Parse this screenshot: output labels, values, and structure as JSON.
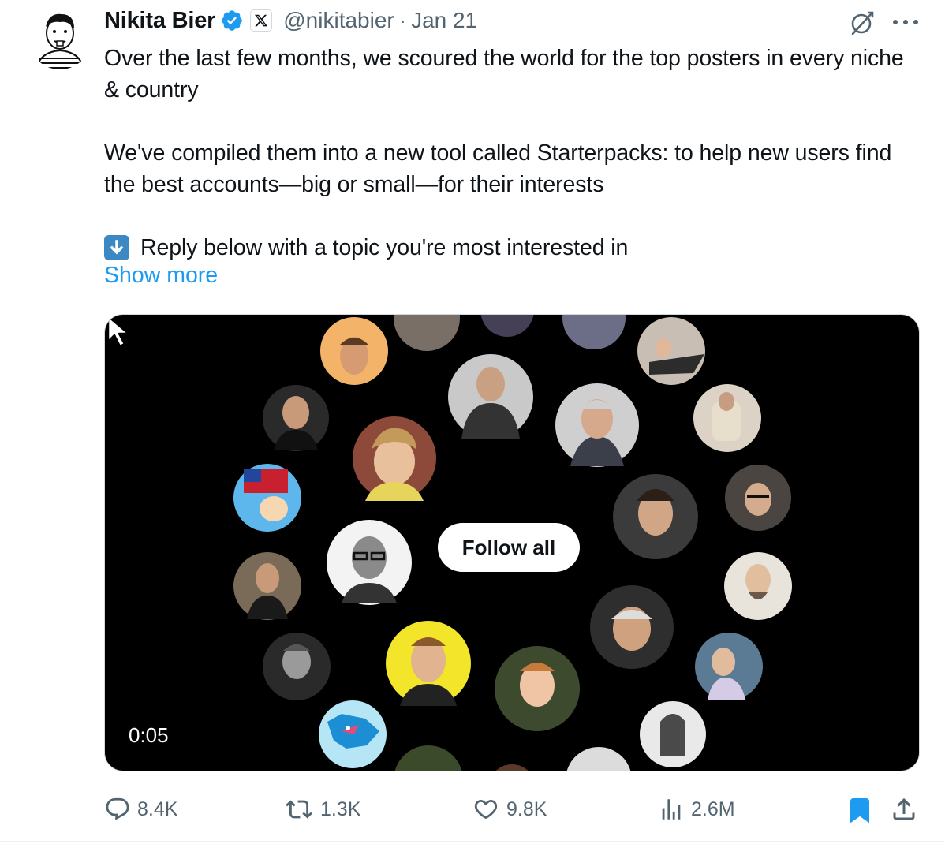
{
  "author": {
    "name": "Nikita Bier",
    "handle": "@nikitabier",
    "separator": "·",
    "date": "Jan 21"
  },
  "tweet": {
    "paragraph1": "Over the last few months, we scoured the world for the top posters in every niche & country",
    "paragraph2": "We've compiled them into a new tool called Starterpacks: to help new users find the best accounts—big or small—for their interests",
    "paragraph3": "Reply below with a topic you're most interested in",
    "show_more": "Show more"
  },
  "media": {
    "follow_button": "Follow all",
    "timestamp": "0:05"
  },
  "stats": {
    "replies": "8.4K",
    "reposts": "1.3K",
    "likes": "9.8K",
    "views": "2.6M"
  },
  "icons": {
    "verified": "verified-badge-icon",
    "affiliation": "x-logo-icon",
    "grok": "grok-icon",
    "more": "more-icon",
    "reply": "reply-icon",
    "repost": "repost-icon",
    "like": "like-icon",
    "views": "views-icon",
    "bookmark": "bookmark-icon",
    "share": "share-icon"
  },
  "colors": {
    "accent": "#1d9bf0",
    "secondary_text": "#536471",
    "media_background": "#000000"
  }
}
